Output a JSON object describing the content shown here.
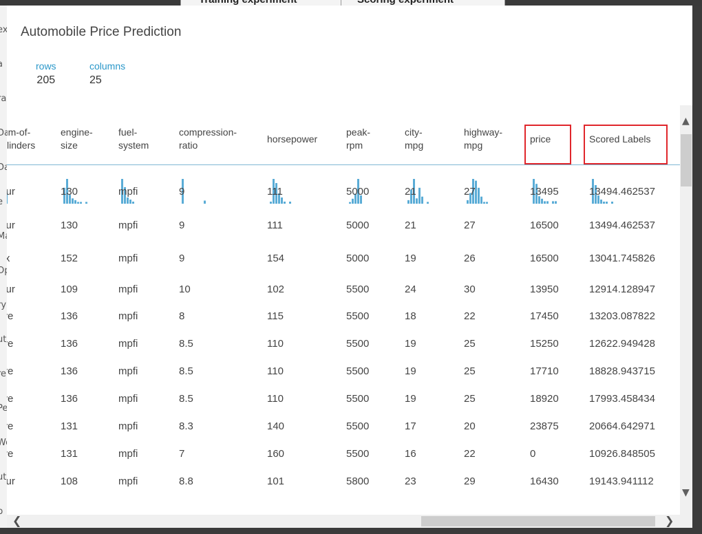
{
  "background": {
    "tabs": [
      "Training experiment",
      "Scoring experiment"
    ],
    "left_glyphs": [
      "ex",
      "a",
      "ra",
      "Da",
      "Da",
      "e",
      "Ma",
      "Op",
      "ry",
      "ut",
      "re",
      "Pe",
      "Wo",
      "ute",
      "p"
    ]
  },
  "dialog": {
    "title": "Automobile Price Prediction",
    "stats": {
      "rows_label": "rows",
      "rows_value": "205",
      "columns_label": "columns",
      "columns_value": "25"
    }
  },
  "table": {
    "columns": [
      {
        "l1": "num-of-",
        "l2": "cylinders",
        "highlight": false
      },
      {
        "l1": "engine-",
        "l2": "size",
        "highlight": false
      },
      {
        "l1": "fuel-",
        "l2": "system",
        "highlight": false
      },
      {
        "l1": "compression-",
        "l2": "ratio",
        "highlight": false
      },
      {
        "l1": "horsepower",
        "l2": "",
        "highlight": false
      },
      {
        "l1": "peak-",
        "l2": "rpm",
        "highlight": false
      },
      {
        "l1": "city-",
        "l2": "mpg",
        "highlight": false
      },
      {
        "l1": "highway-",
        "l2": "mpg",
        "highlight": false
      },
      {
        "l1": "price",
        "l2": "",
        "highlight": true
      },
      {
        "l1": "Scored Labels",
        "l2": "",
        "highlight": true
      }
    ],
    "histograms": [
      [
        2,
        2,
        1
      ],
      [
        9,
        14,
        5,
        3,
        2,
        1,
        1,
        0,
        1
      ],
      [
        12,
        8,
        3,
        2,
        1
      ],
      [
        16,
        0,
        0,
        0,
        0,
        0,
        0,
        0,
        2
      ],
      [
        1,
        12,
        10,
        5,
        3,
        1,
        0,
        1
      ],
      [
        1,
        3,
        6,
        15,
        5
      ],
      [
        2,
        8,
        14,
        3,
        9,
        4,
        0,
        1
      ],
      [
        2,
        6,
        14,
        13,
        9,
        4,
        1,
        1
      ],
      [
        10,
        8,
        3,
        2,
        1,
        1,
        0,
        1,
        1
      ],
      [
        12,
        9,
        4,
        2,
        1,
        1,
        0,
        1
      ]
    ],
    "accent_color": "#5aacd6",
    "highlight_color": "#e0262b",
    "rows": [
      [
        "four",
        "130",
        "mpfi",
        "9",
        "111",
        "5000",
        "21",
        "27",
        "13495",
        "13494.462537"
      ],
      [
        "four",
        "130",
        "mpfi",
        "9",
        "111",
        "5000",
        "21",
        "27",
        "16500",
        "13494.462537"
      ],
      [
        "six",
        "152",
        "mpfi",
        "9",
        "154",
        "5000",
        "19",
        "26",
        "16500",
        "13041.745826"
      ],
      [
        "four",
        "109",
        "mpfi",
        "10",
        "102",
        "5500",
        "24",
        "30",
        "13950",
        "12914.128947"
      ],
      [
        "five",
        "136",
        "mpfi",
        "8",
        "115",
        "5500",
        "18",
        "22",
        "17450",
        "13203.087822"
      ],
      [
        "five",
        "136",
        "mpfi",
        "8.5",
        "110",
        "5500",
        "19",
        "25",
        "15250",
        "12622.949428"
      ],
      [
        "five",
        "136",
        "mpfi",
        "8.5",
        "110",
        "5500",
        "19",
        "25",
        "17710",
        "18828.943715"
      ],
      [
        "five",
        "136",
        "mpfi",
        "8.5",
        "110",
        "5500",
        "19",
        "25",
        "18920",
        "17993.458434"
      ],
      [
        "five",
        "131",
        "mpfi",
        "8.3",
        "140",
        "5500",
        "17",
        "20",
        "23875",
        "20664.642971"
      ],
      [
        "five",
        "131",
        "mpfi",
        "7",
        "160",
        "5500",
        "16",
        "22",
        "0",
        "10926.848505"
      ],
      [
        "four",
        "108",
        "mpfi",
        "8.8",
        "101",
        "5800",
        "23",
        "29",
        "16430",
        "19143.941112"
      ]
    ]
  },
  "scrollbars": {
    "up_icon": "▲",
    "down_icon": "▼",
    "left_icon": "❮",
    "right_icon": "❯"
  }
}
